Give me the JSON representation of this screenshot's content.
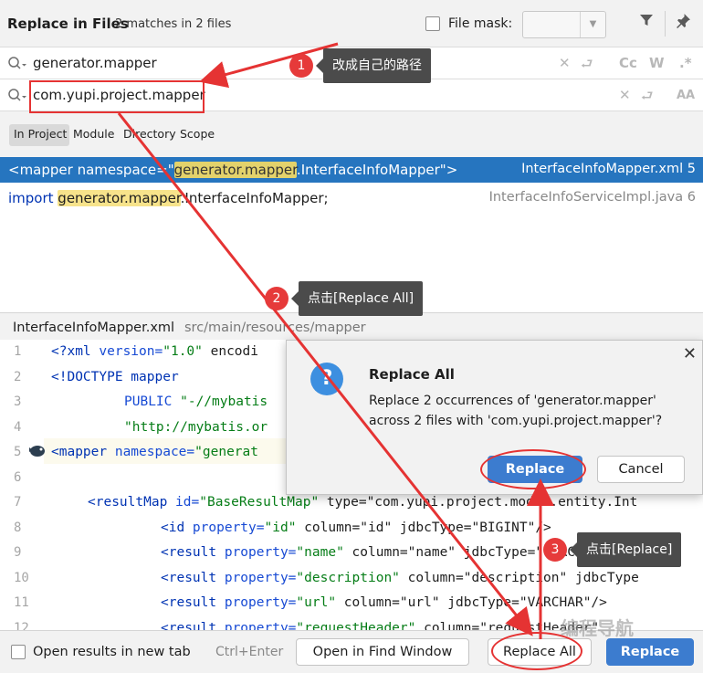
{
  "header": {
    "title": "Replace in Files",
    "match_count": "2 matches in 2 files",
    "file_mask_label": "File mask:",
    "filter_icon": "filter-icon",
    "pin_icon": "pin-icon"
  },
  "search": {
    "find_value": "generator.mapper",
    "replace_value": "com.yupi.project.mapper",
    "find_options": [
      "Cc",
      "W",
      ".*"
    ],
    "replace_options": [
      "AA"
    ]
  },
  "scope_tabs": [
    "In Project",
    "Module",
    "Directory",
    "Scope"
  ],
  "results": [
    {
      "prefix": "<mapper namespace=\"",
      "match": "generator.mapper",
      "suffix": ".InterfaceInfoMapper\">",
      "file": "InterfaceInfoMapper.xml 5"
    },
    {
      "prefix": "import ",
      "match": "generator.mapper",
      "suffix": ".InterfaceInfoMapper;",
      "file": "InterfaceInfoServiceImpl.java 6"
    }
  ],
  "preview": {
    "file_name": "InterfaceInfoMapper.xml",
    "file_path": "src/main/resources/mapper",
    "line_numbers": [
      "1",
      "2",
      "3",
      "4",
      "5",
      "6",
      "7",
      "8",
      "9",
      "10",
      "11",
      "12"
    ],
    "lines": [
      {
        "tag": "<?xml ",
        "attr": "version=",
        "val": "\"1.0\"",
        "rest": " encodi"
      },
      {
        "tag": "<!DOCTYPE mapper",
        "attr": "",
        "val": "",
        "rest": ""
      },
      {
        "tag": "",
        "attr": "PUBLIC ",
        "val": "\"-//mybatis",
        "rest": ""
      },
      {
        "tag": "",
        "attr": "",
        "val": "\"http://mybatis.or",
        "rest": ""
      },
      {
        "tag": "<mapper ",
        "attr": "namespace=",
        "val": "\"generat",
        "rest": ""
      },
      {
        "tag": "",
        "attr": "",
        "val": "",
        "rest": ""
      },
      {
        "tag": "<resultMap ",
        "attr": "id=",
        "val": "\"BaseResultMap\"",
        "rest": " type=\"com.yupi.project.model.entity.Int"
      },
      {
        "tag": "<id ",
        "attr": "property=",
        "val": "\"id\"",
        "rest": " column=\"id\" jdbcType=\"BIGINT\"/>"
      },
      {
        "tag": "<result ",
        "attr": "property=",
        "val": "\"name\"",
        "rest": " column=\"name\" jdbcType=\"VARCHAR\"/>"
      },
      {
        "tag": "<result ",
        "attr": "property=",
        "val": "\"description\"",
        "rest": " column=\"description\" jdbcType"
      },
      {
        "tag": "<result ",
        "attr": "property=",
        "val": "\"url\"",
        "rest": " column=\"url\" jdbcType=\"VARCHAR\"/>"
      },
      {
        "tag": "<result ",
        "attr": "property=",
        "val": "\"requestHeader\"",
        "rest": " column=\"requestHeader\""
      }
    ]
  },
  "dialog": {
    "title": "Replace All",
    "message_line1": "Replace 2 occurrences of 'generator.mapper'",
    "message_line2": "across 2 files with 'com.yupi.project.mapper'?",
    "replace_button": "Replace",
    "cancel_button": "Cancel"
  },
  "bottom": {
    "open_new_tab_label": "Open results in new tab",
    "shortcut": "Ctrl+Enter",
    "open_find_window": "Open in Find Window",
    "replace_all": "Replace All",
    "replace": "Replace"
  },
  "annotations": [
    {
      "number": "1",
      "text": "改成自己的路径"
    },
    {
      "number": "2",
      "text": "点击[Replace All]"
    },
    {
      "number": "3",
      "text": "点击[Replace]"
    }
  ],
  "watermark": "编程导航"
}
